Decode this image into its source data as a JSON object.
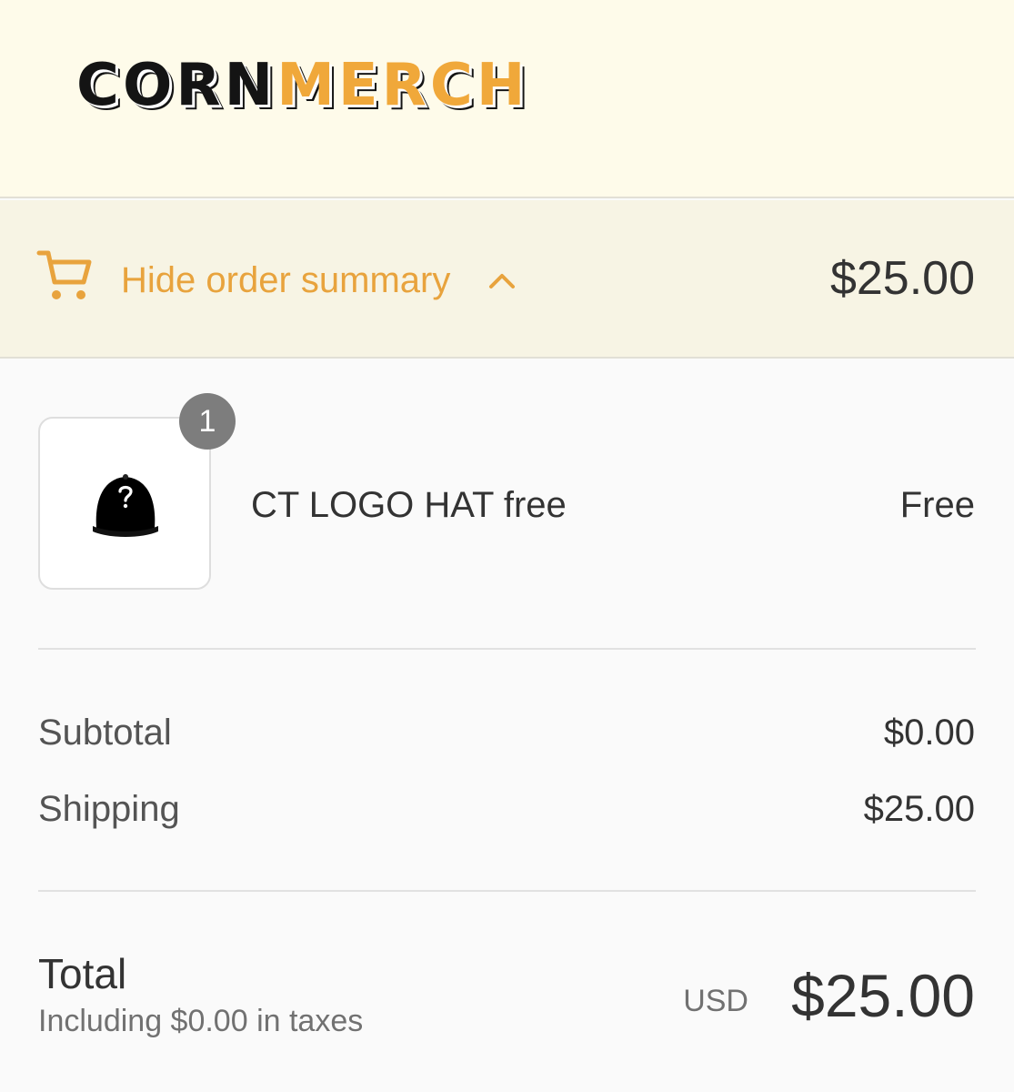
{
  "header": {
    "logo_part1": "CORN",
    "logo_part2": "MERCH"
  },
  "summary_bar": {
    "icon": "cart-icon",
    "toggle_label": "Hide order summary",
    "chevron": "chevron-up-icon",
    "total": "$25.00",
    "accent_color": "#e8a33d"
  },
  "line_items": [
    {
      "image_icon": "hat-icon",
      "quantity": "1",
      "name": "CT LOGO HAT free",
      "price": "Free"
    }
  ],
  "costs": {
    "subtotal_label": "Subtotal",
    "subtotal_value": "$0.00",
    "shipping_label": "Shipping",
    "shipping_value": "$25.00"
  },
  "total": {
    "label": "Total",
    "tax_note": "Including $0.00 in taxes",
    "currency": "USD",
    "amount": "$25.00"
  }
}
